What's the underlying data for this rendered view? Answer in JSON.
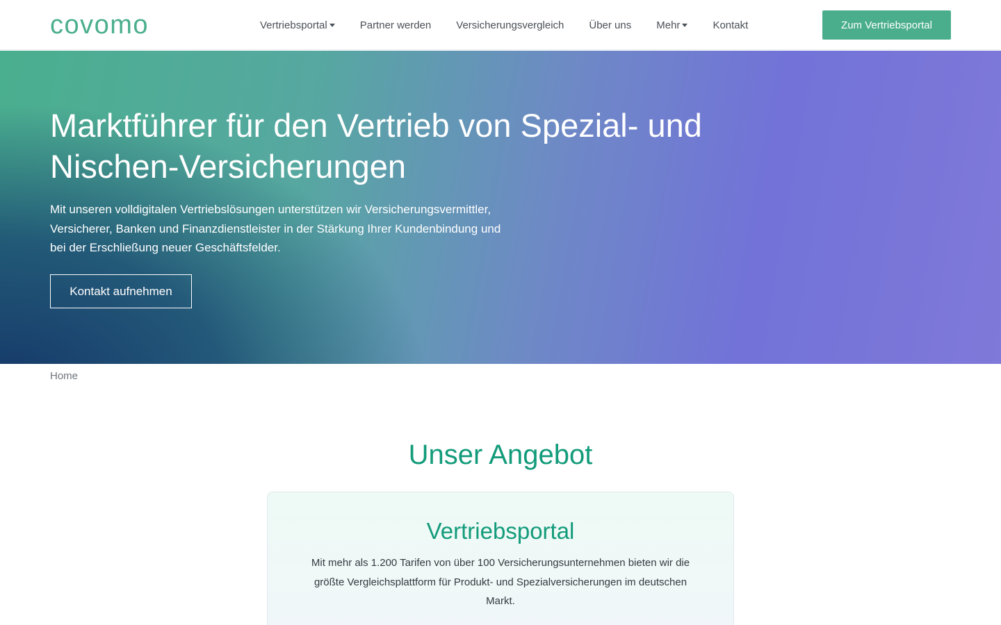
{
  "header": {
    "logo_text": "covomo",
    "nav": [
      {
        "label": "Vertriebsportal",
        "dropdown": true
      },
      {
        "label": "Partner werden",
        "dropdown": false
      },
      {
        "label": "Versicherungsvergleich",
        "dropdown": false
      },
      {
        "label": "Über uns",
        "dropdown": false
      },
      {
        "label": "Mehr",
        "dropdown": true
      },
      {
        "label": "Kontakt",
        "dropdown": false
      }
    ],
    "cta_label": "Zum Vertriebsportal"
  },
  "hero": {
    "title": "Marktführer für den Vertrieb von Spezial- und Nischen-Versicherungen",
    "text": "Mit unseren volldigitalen Vertriebslösungen unterstützen wir Versicherungsvermittler, Versicherer, Banken und Finanzdienstleister in der Stärkung Ihrer Kundenbindung und bei der Erschließung neuer Geschäftsfelder.",
    "button_label": "Kontakt aufnehmen"
  },
  "breadcrumb": {
    "home_label": "Home"
  },
  "offer": {
    "section_title": "Unser Angebot",
    "card_title": "Vertriebsportal",
    "card_text": "Mit mehr als 1.200 Tarifen von über 100 Versicherungsunternehmen bieten wir die größte Vergleichsplattform für Produkt- und Spezialversicherungen im deutschen Markt."
  },
  "colors": {
    "brand_green": "#4aae8c",
    "heading_green": "#129b7a",
    "hero_purple": "#7272d8",
    "hero_navy": "#143468"
  }
}
